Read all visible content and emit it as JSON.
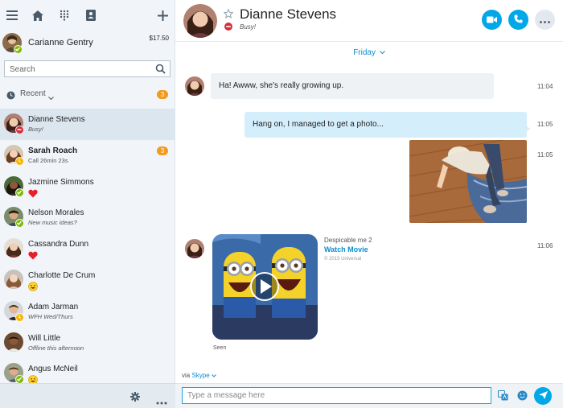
{
  "sidebar": {
    "topbar_icons": [
      "menu-icon",
      "home-icon",
      "dialpad-icon",
      "contacts-book-icon",
      "plus-icon"
    ],
    "me": {
      "name": "Carianne Gentry",
      "credit": "$17.50",
      "status": "online"
    },
    "search": {
      "placeholder": "Search"
    },
    "recent": {
      "label": "Recent",
      "badge": "3"
    },
    "contacts": [
      {
        "name": "Dianne Stevens",
        "sub": "Busy!",
        "status": "busy",
        "selected": true,
        "bold": false,
        "italic": true,
        "emoticon": ""
      },
      {
        "name": "Sarah Roach",
        "sub": "Call 26min 23s",
        "status": "away",
        "selected": false,
        "bold": true,
        "italic": false,
        "badge": "3",
        "emoticon": ""
      },
      {
        "name": "Jazmine Simmons",
        "sub": "",
        "status": "online",
        "selected": false,
        "bold": false,
        "italic": false,
        "emoticon": "heart-emoticon"
      },
      {
        "name": "Nelson Morales",
        "sub": "New music ideas?",
        "status": "online",
        "selected": false,
        "bold": false,
        "italic": true,
        "emoticon": ""
      },
      {
        "name": "Cassandra Dunn",
        "sub": "",
        "status": "none",
        "selected": false,
        "bold": false,
        "italic": false,
        "emoticon": "heart-emoticon"
      },
      {
        "name": "Charlotte De Crum",
        "sub": "",
        "status": "none",
        "selected": false,
        "bold": false,
        "italic": false,
        "emoticon": "smile-emoticon"
      },
      {
        "name": "Adam Jarman",
        "sub": "WFH Wed/Thurs",
        "status": "away",
        "selected": false,
        "bold": false,
        "italic": true,
        "emoticon": ""
      },
      {
        "name": "Will Little",
        "sub": "Offline this afternoon",
        "status": "none",
        "selected": false,
        "bold": false,
        "italic": true,
        "emoticon": ""
      },
      {
        "name": "Angus McNeil",
        "sub": "",
        "status": "online",
        "selected": false,
        "bold": false,
        "italic": false,
        "emoticon": "smile-emoticon"
      }
    ],
    "footer_icons": [
      "gear-icon",
      "more-icon"
    ]
  },
  "header": {
    "name": "Dianne Stevens",
    "status_text": "Busy!",
    "buttons": [
      "video-call-button",
      "audio-call-button",
      "more-button"
    ]
  },
  "conversation": {
    "day_label": "Friday",
    "messages": [
      {
        "direction": "in",
        "text": "Ha! Awww, she's really growing up.",
        "time": "11:04"
      },
      {
        "direction": "out",
        "text": "Hang on, I managed to get a photo...",
        "time": "11:05"
      },
      {
        "direction": "out",
        "type": "photo",
        "time": "11:05"
      },
      {
        "direction": "in",
        "type": "movie",
        "title": "Despicable me 2",
        "link": "Watch Movie",
        "copyright": "© 2015 Universal",
        "time": "11:06",
        "seen": "Seen"
      }
    ]
  },
  "composer": {
    "via_prefix": "via",
    "via_service": "Skype",
    "placeholder": "Type a message here"
  },
  "colors": {
    "accent": "#00a8e8",
    "busy": "#d82d39",
    "online": "#7fba00",
    "away": "#f7b500",
    "badge": "#f29a1b"
  }
}
